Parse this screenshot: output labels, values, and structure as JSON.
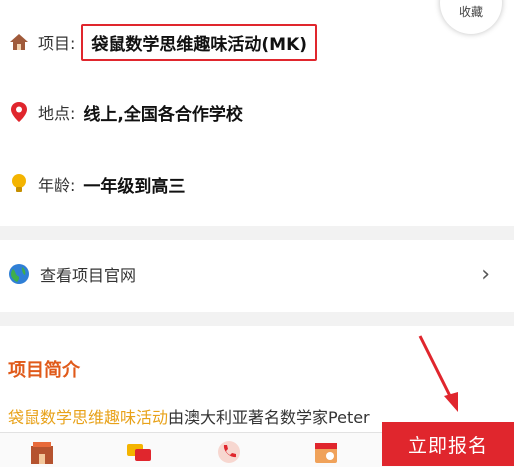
{
  "favorite": {
    "label": "收藏"
  },
  "info": {
    "project_label": "项目:",
    "project_value": "袋鼠数学思维趣味活动(MK)",
    "location_label": "地点:",
    "location_value": "线上,全国各合作学校",
    "age_label": "年龄:",
    "age_value": "一年级到高三"
  },
  "website": {
    "label": "查看项目官网"
  },
  "intro": {
    "title": "项目简介",
    "highlight": "袋鼠数学思维趣味活动",
    "text": "由澳大利亚著名数学家Peter"
  },
  "bottom": {
    "signup_label": "立即报名"
  },
  "colors": {
    "accent": "#e0262d",
    "title": "#e05a1a",
    "highlight": "#e8a21a"
  }
}
